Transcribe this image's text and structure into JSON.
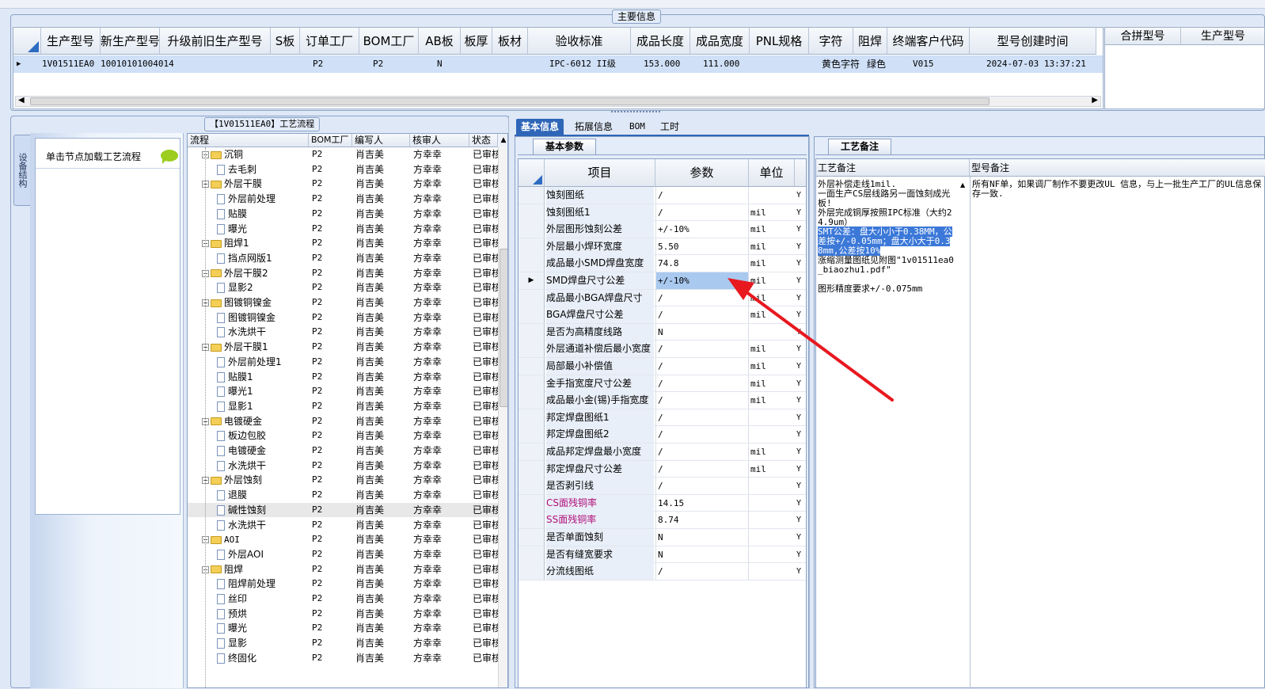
{
  "main_info": {
    "title": "主要信息",
    "columns": [
      "生产型号",
      "新生产型号",
      "升级前旧生产型号",
      "S板",
      "订单工厂",
      "BOM工厂",
      "AB板",
      "板厚",
      "板材",
      "验收标准",
      "成品长度",
      "成品宽度",
      "PNL规格",
      "字符",
      "阻焊",
      "终端客户代码",
      "型号创建时间"
    ],
    "row": {
      "marker": "▶",
      "生产型号": "1V01511EA0",
      "新生产型号": "10010101004014",
      "订单工厂": "P2",
      "BOM工厂": "P2",
      "AB板": "N",
      "验收标准": "IPC-6012 II级",
      "成品长度": "153.000",
      "成品宽度": "111.000",
      "字符": "黄色字符",
      "阻焊": "绿色",
      "终端客户代码": "V015",
      "型号创建时间": "2024-07-03 13:37:21"
    },
    "side_columns": [
      "合拼型号",
      "生产型号"
    ]
  },
  "left_panel": {
    "side_tab": "设备结构",
    "load_flow_label": "单击节点加载工艺流程",
    "flow_title": "【1V01511EA0】工艺流程",
    "tree_columns": [
      "流程",
      "BOM工厂",
      "编写人",
      "核审人",
      "状态"
    ],
    "tree_rows": [
      {
        "level": 1,
        "name": "沉铜",
        "bom": "P2",
        "writer": "肖吉美",
        "checker": "方幸幸",
        "status": "已审核"
      },
      {
        "level": 2,
        "name": "去毛刺",
        "bom": "P2",
        "writer": "肖吉美",
        "checker": "方幸幸",
        "status": "已审核"
      },
      {
        "level": 1,
        "name": "外层干膜",
        "bom": "P2",
        "writer": "肖吉美",
        "checker": "方幸幸",
        "status": "已审核"
      },
      {
        "level": 2,
        "name": "外层前处理",
        "bom": "P2",
        "writer": "肖吉美",
        "checker": "方幸幸",
        "status": "已审核"
      },
      {
        "level": 2,
        "name": "贴膜",
        "bom": "P2",
        "writer": "肖吉美",
        "checker": "方幸幸",
        "status": "已审核"
      },
      {
        "level": 2,
        "name": "曝光",
        "bom": "P2",
        "writer": "肖吉美",
        "checker": "方幸幸",
        "status": "已审核"
      },
      {
        "level": 1,
        "name": "阻焊1",
        "bom": "P2",
        "writer": "肖吉美",
        "checker": "方幸幸",
        "status": "已审核"
      },
      {
        "level": 2,
        "name": "挡点网版1",
        "bom": "P2",
        "writer": "肖吉美",
        "checker": "方幸幸",
        "status": "已审核"
      },
      {
        "level": 1,
        "name": "外层干膜2",
        "bom": "P2",
        "writer": "肖吉美",
        "checker": "方幸幸",
        "status": "已审核"
      },
      {
        "level": 2,
        "name": "显影2",
        "bom": "P2",
        "writer": "肖吉美",
        "checker": "方幸幸",
        "status": "已审核"
      },
      {
        "level": 1,
        "name": "图镀铜镍金",
        "bom": "P2",
        "writer": "肖吉美",
        "checker": "方幸幸",
        "status": "已审核"
      },
      {
        "level": 2,
        "name": "图镀铜镍金",
        "bom": "P2",
        "writer": "肖吉美",
        "checker": "方幸幸",
        "status": "已审核"
      },
      {
        "level": 2,
        "name": "水洗烘干",
        "bom": "P2",
        "writer": "肖吉美",
        "checker": "方幸幸",
        "status": "已审核"
      },
      {
        "level": 1,
        "name": "外层干膜1",
        "bom": "P2",
        "writer": "肖吉美",
        "checker": "方幸幸",
        "status": "已审核"
      },
      {
        "level": 2,
        "name": "外层前处理1",
        "bom": "P2",
        "writer": "肖吉美",
        "checker": "方幸幸",
        "status": "已审核"
      },
      {
        "level": 2,
        "name": "贴膜1",
        "bom": "P2",
        "writer": "肖吉美",
        "checker": "方幸幸",
        "status": "已审核"
      },
      {
        "level": 2,
        "name": "曝光1",
        "bom": "P2",
        "writer": "肖吉美",
        "checker": "方幸幸",
        "status": "已审核"
      },
      {
        "level": 2,
        "name": "显影1",
        "bom": "P2",
        "writer": "肖吉美",
        "checker": "方幸幸",
        "status": "已审核"
      },
      {
        "level": 1,
        "name": "电镀硬金",
        "bom": "P2",
        "writer": "肖吉美",
        "checker": "方幸幸",
        "status": "已审核"
      },
      {
        "level": 2,
        "name": "板边包胶",
        "bom": "P2",
        "writer": "肖吉美",
        "checker": "方幸幸",
        "status": "已审核"
      },
      {
        "level": 2,
        "name": "电镀硬金",
        "bom": "P2",
        "writer": "肖吉美",
        "checker": "方幸幸",
        "status": "已审核"
      },
      {
        "level": 2,
        "name": "水洗烘干",
        "bom": "P2",
        "writer": "肖吉美",
        "checker": "方幸幸",
        "status": "已审核"
      },
      {
        "level": 1,
        "name": "外层蚀刻",
        "bom": "P2",
        "writer": "肖吉美",
        "checker": "方幸幸",
        "status": "已审核"
      },
      {
        "level": 2,
        "name": "退膜",
        "bom": "P2",
        "writer": "肖吉美",
        "checker": "方幸幸",
        "status": "已审核"
      },
      {
        "level": 2,
        "name": "碱性蚀刻",
        "bom": "P2",
        "writer": "肖吉美",
        "checker": "方幸幸",
        "status": "已审核",
        "selected": true
      },
      {
        "level": 2,
        "name": "水洗烘干",
        "bom": "P2",
        "writer": "肖吉美",
        "checker": "方幸幸",
        "status": "已审核"
      },
      {
        "level": 1,
        "name": "AOI",
        "bom": "P2",
        "writer": "肖吉美",
        "checker": "方幸幸",
        "status": "已审核"
      },
      {
        "level": 2,
        "name": "外层AOI",
        "bom": "P2",
        "writer": "肖吉美",
        "checker": "方幸幸",
        "status": "已审核"
      },
      {
        "level": 1,
        "name": "阻焊",
        "bom": "P2",
        "writer": "肖吉美",
        "checker": "方幸幸",
        "status": "已审核"
      },
      {
        "level": 2,
        "name": "阻焊前处理",
        "bom": "P2",
        "writer": "肖吉美",
        "checker": "方幸幸",
        "status": "已审核"
      },
      {
        "level": 2,
        "name": "丝印",
        "bom": "P2",
        "writer": "肖吉美",
        "checker": "方幸幸",
        "status": "已审核"
      },
      {
        "level": 2,
        "name": "预烘",
        "bom": "P2",
        "writer": "肖吉美",
        "checker": "方幸幸",
        "status": "已审核"
      },
      {
        "level": 2,
        "name": "曝光",
        "bom": "P2",
        "writer": "肖吉美",
        "checker": "方幸幸",
        "status": "已审核"
      },
      {
        "level": 2,
        "name": "显影",
        "bom": "P2",
        "writer": "肖吉美",
        "checker": "方幸幸",
        "status": "已审核"
      },
      {
        "level": 2,
        "name": "终固化",
        "bom": "P2",
        "writer": "肖吉美",
        "checker": "方幸幸",
        "status": "已审核"
      }
    ]
  },
  "tabs": [
    "基本信息",
    "拓展信息",
    "BOM",
    "工时"
  ],
  "basic_params": {
    "title": "基本参数",
    "columns": [
      "项目",
      "参数",
      "单位"
    ],
    "rows": [
      {
        "item": "蚀刻图纸",
        "value": "/",
        "unit": "",
        "flag": "Y"
      },
      {
        "item": "蚀刻图纸1",
        "value": "/",
        "unit": "mil",
        "flag": "Y"
      },
      {
        "item": "外层图形蚀刻公差",
        "value": "+/-10%",
        "unit": "mil",
        "flag": "Y"
      },
      {
        "item": "外层最小焊环宽度",
        "value": "5.50",
        "unit": "mil",
        "flag": "Y"
      },
      {
        "item": "成品最小SMD焊盘宽度",
        "value": "74.8",
        "unit": "mil",
        "flag": "Y"
      },
      {
        "item": "SMD焊盘尺寸公差",
        "value": "+/-10%",
        "unit": "mil",
        "flag": "Y",
        "current": true
      },
      {
        "item": "成品最小BGA焊盘尺寸",
        "value": "/",
        "unit": "mil",
        "flag": "Y"
      },
      {
        "item": "BGA焊盘尺寸公差",
        "value": "/",
        "unit": "mil",
        "flag": "Y"
      },
      {
        "item": "是否为高精度线路",
        "value": "N",
        "unit": "",
        "flag": "Y"
      },
      {
        "item": "外层通道补偿后最小宽度",
        "value": "/",
        "unit": "mil",
        "flag": "Y"
      },
      {
        "item": "局部最小补偿值",
        "value": "/",
        "unit": "mil",
        "flag": "Y"
      },
      {
        "item": "金手指宽度尺寸公差",
        "value": "/",
        "unit": "mil",
        "flag": "Y"
      },
      {
        "item": "成品最小金(锡)手指宽度",
        "value": "/",
        "unit": "mil",
        "flag": "Y"
      },
      {
        "item": "邦定焊盘图纸1",
        "value": "/",
        "unit": "",
        "flag": "Y"
      },
      {
        "item": "邦定焊盘图纸2",
        "value": "/",
        "unit": "",
        "flag": "Y"
      },
      {
        "item": "成品邦定焊盘最小宽度",
        "value": "/",
        "unit": "mil",
        "flag": "Y"
      },
      {
        "item": "邦定焊盘尺寸公差",
        "value": "/",
        "unit": "mil",
        "flag": "Y"
      },
      {
        "item": "是否剥引线",
        "value": "/",
        "unit": "",
        "flag": "Y"
      },
      {
        "item": "CS面残铜率",
        "value": "14.15",
        "unit": "",
        "flag": "Y",
        "pink": true
      },
      {
        "item": "SS面残铜率",
        "value": "8.74",
        "unit": "",
        "flag": "Y",
        "pink": true
      },
      {
        "item": "是否单面蚀刻",
        "value": "N",
        "unit": "",
        "flag": "Y"
      },
      {
        "item": "是否有缝宽要求",
        "value": "N",
        "unit": "",
        "flag": "Y"
      },
      {
        "item": "分流线图纸",
        "value": "/",
        "unit": "",
        "flag": "Y"
      }
    ]
  },
  "process_notes": {
    "title": "工艺备注",
    "col1": "工艺备注",
    "col2": "型号备注",
    "note1_part1": "外层补偿走线1mil.\n一面生产CS层线路另一面蚀刻成光板!\n外层完成铜厚按照IPC标准（大约24.9um）\n",
    "note1_highlight": "SMT公差：盘大小小于0.38MM，公差按+/-0.05mm；盘大小大于0.38mm,公差按10%",
    "note1_part2": "\n涨缩测量图纸见附图\"1v01511ea0_biaozhu1.pdf\"\n\n图形精度要求+/-0.075mm",
    "note2": "所有NF单，如果调厂制作不要更改UL 信息，与上一批生产工厂的UL信息保存一致."
  },
  "colors": {
    "accent": "#1c5fb8",
    "selected_row": "#cfe0f7",
    "highlight": "#3b78d8",
    "arrow": "#e8181f",
    "pink": "#b0107a"
  }
}
